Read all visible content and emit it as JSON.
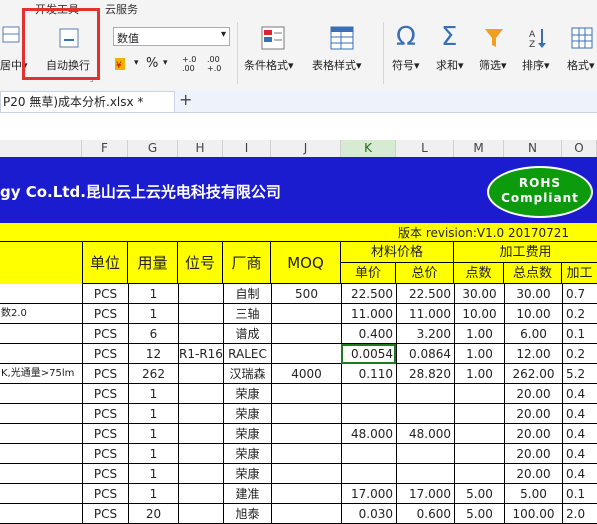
{
  "menu": {
    "dev_tools": "开发工具",
    "cloud": "云服务"
  },
  "ribbon": {
    "merge_center": "居中▾",
    "wrap_text": "自动换行",
    "number_format": "数值",
    "percent": "%",
    "comma": "▾",
    "inc_decimal": "+.0 .00",
    "dec_decimal": ".00 +.0",
    "cond_format": "条件格式▾",
    "table_style": "表格样式▾",
    "symbol": "符号▾",
    "sum": "求和▾",
    "filter": "筛选▾",
    "sort": "排序▾",
    "format": "格式▾"
  },
  "file_tab": {
    "name": "P20 無草)成本分析.xlsx *",
    "new_tab": "+"
  },
  "columns": [
    "F",
    "G",
    "H",
    "I",
    "J",
    "K",
    "L",
    "M",
    "N",
    "O"
  ],
  "title": "gy Co.Ltd.昆山云上云光电科技有限公司",
  "rohs": {
    "line1": "ROHS",
    "line2": "Compliant"
  },
  "revision": "版本 revision:V1.0 20170721",
  "headers": {
    "unit": "单位",
    "qty": "用量",
    "pos": "位号",
    "vendor": "厂商",
    "moq": "MOQ",
    "material_price": "材料价格",
    "unit_price": "单价",
    "total_price": "总价",
    "processing_fee": "加工费用",
    "points": "点数",
    "total_points": "总点数",
    "proc": "加工"
  },
  "rows": [
    {
      "desc": "",
      "unit": "PCS",
      "qty": "1",
      "pos": "",
      "vendor": "自制",
      "moq": "500",
      "k": "22.500",
      "l": "22.500",
      "m": "30.00",
      "n": "30.00",
      "o": "0.7"
    },
    {
      "desc": "数2.0",
      "unit": "PCS",
      "qty": "1",
      "pos": "",
      "vendor": "三轴",
      "moq": "",
      "k": "11.000",
      "l": "11.000",
      "m": "10.00",
      "n": "10.00",
      "o": "0.2"
    },
    {
      "desc": "",
      "unit": "PCS",
      "qty": "6",
      "pos": "",
      "vendor": "谱成",
      "moq": "",
      "k": "0.400",
      "l": "3.200",
      "m": "1.00",
      "n": "6.00",
      "o": "0.1"
    },
    {
      "desc": "",
      "unit": "PCS",
      "qty": "12",
      "pos": "R1-R16",
      "vendor": "RALEC",
      "moq": "",
      "k": "0.0054",
      "l": "0.0864",
      "m": "1.00",
      "n": "12.00",
      "o": "0.2"
    },
    {
      "desc": "K,光通量>75lm",
      "unit": "PCS",
      "qty": "262",
      "pos": "",
      "vendor": "汉瑞森",
      "moq": "4000",
      "k": "0.110",
      "l": "28.820",
      "m": "1.00",
      "n": "262.00",
      "o": "5.2"
    },
    {
      "desc": "",
      "unit": "PCS",
      "qty": "1",
      "pos": "",
      "vendor": "荣康",
      "moq": "",
      "k": "",
      "l": "",
      "m": "",
      "n": "20.00",
      "o": "0.4"
    },
    {
      "desc": "",
      "unit": "PCS",
      "qty": "1",
      "pos": "",
      "vendor": "荣康",
      "moq": "",
      "k": "",
      "l": "",
      "m": "",
      "n": "20.00",
      "o": "0.4"
    },
    {
      "desc": "",
      "unit": "PCS",
      "qty": "1",
      "pos": "",
      "vendor": "荣康",
      "moq": "",
      "k": "48.000",
      "l": "48.000",
      "m": "",
      "n": "20.00",
      "o": "0.4"
    },
    {
      "desc": "",
      "unit": "PCS",
      "qty": "1",
      "pos": "",
      "vendor": "荣康",
      "moq": "",
      "k": "",
      "l": "",
      "m": "",
      "n": "20.00",
      "o": "0.4"
    },
    {
      "desc": "",
      "unit": "PCS",
      "qty": "1",
      "pos": "",
      "vendor": "荣康",
      "moq": "",
      "k": "",
      "l": "",
      "m": "",
      "n": "20.00",
      "o": "0.4"
    },
    {
      "desc": "",
      "unit": "PCS",
      "qty": "1",
      "pos": "",
      "vendor": "建准",
      "moq": "",
      "k": "17.000",
      "l": "17.000",
      "m": "5.00",
      "n": "5.00",
      "o": "0.1"
    },
    {
      "desc": "",
      "unit": "PCS",
      "qty": "20",
      "pos": "",
      "vendor": "旭泰",
      "moq": "",
      "k": "0.030",
      "l": "0.600",
      "m": "5.00",
      "n": "100.00",
      "o": "2.0"
    }
  ]
}
